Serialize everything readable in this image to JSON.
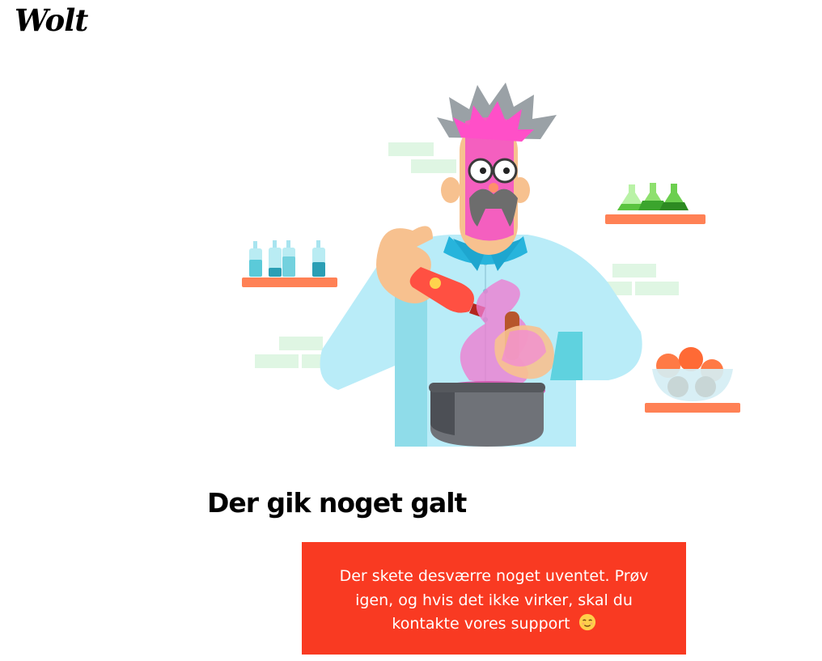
{
  "brand": {
    "logo_text": "Wolt"
  },
  "error": {
    "title": "Der gik noget galt",
    "message": "Der skete desværre noget uventet. Prøv igen, og hvis det ikke virker, skal du kontakte vores support",
    "emoji_icon": "relieved-face-icon",
    "box_color": "#f93a22"
  },
  "illustration": {
    "icon": "chef-scientist-illustration"
  }
}
